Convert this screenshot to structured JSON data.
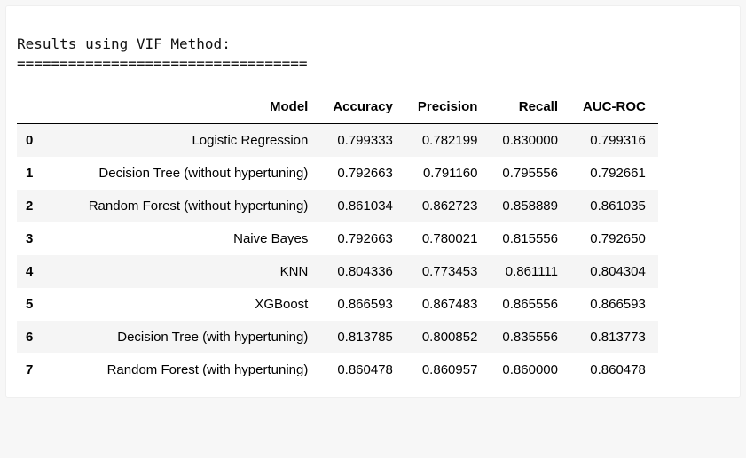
{
  "output": {
    "title_line": "Results using VIF Method:",
    "divider_line": "=================================="
  },
  "table": {
    "columns": [
      "Model",
      "Accuracy",
      "Precision",
      "Recall",
      "AUC-ROC"
    ],
    "rows": [
      {
        "idx": "0",
        "model": "Logistic Regression",
        "accuracy": "0.799333",
        "precision": "0.782199",
        "recall": "0.830000",
        "auc": "0.799316"
      },
      {
        "idx": "1",
        "model": "Decision Tree (without hypertuning)",
        "accuracy": "0.792663",
        "precision": "0.791160",
        "recall": "0.795556",
        "auc": "0.792661"
      },
      {
        "idx": "2",
        "model": "Random Forest (without hypertuning)",
        "accuracy": "0.861034",
        "precision": "0.862723",
        "recall": "0.858889",
        "auc": "0.861035"
      },
      {
        "idx": "3",
        "model": "Naive Bayes",
        "accuracy": "0.792663",
        "precision": "0.780021",
        "recall": "0.815556",
        "auc": "0.792650"
      },
      {
        "idx": "4",
        "model": "KNN",
        "accuracy": "0.804336",
        "precision": "0.773453",
        "recall": "0.861111",
        "auc": "0.804304"
      },
      {
        "idx": "5",
        "model": "XGBoost",
        "accuracy": "0.866593",
        "precision": "0.867483",
        "recall": "0.865556",
        "auc": "0.866593"
      },
      {
        "idx": "6",
        "model": "Decision Tree (with hypertuning)",
        "accuracy": "0.813785",
        "precision": "0.800852",
        "recall": "0.835556",
        "auc": "0.813773"
      },
      {
        "idx": "7",
        "model": "Random Forest (with hypertuning)",
        "accuracy": "0.860478",
        "precision": "0.860957",
        "recall": "0.860000",
        "auc": "0.860478"
      }
    ]
  }
}
